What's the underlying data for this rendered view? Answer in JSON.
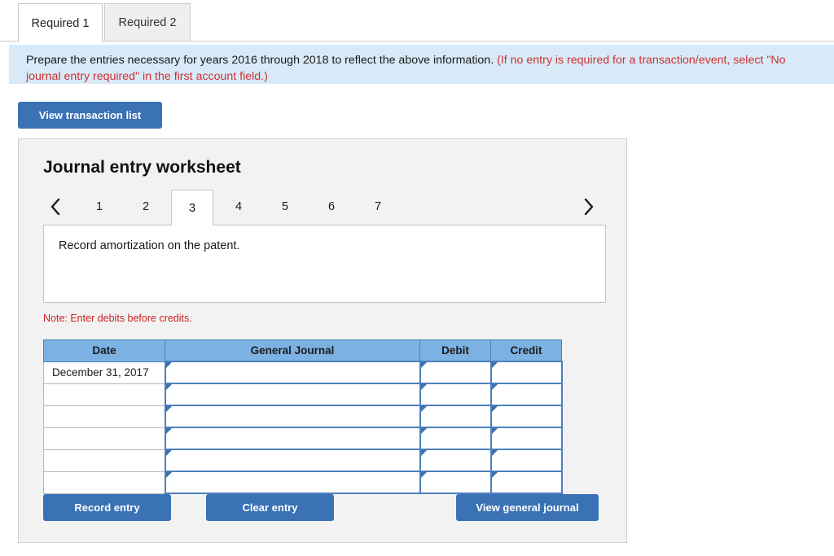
{
  "tabs": [
    {
      "label": "Required 1",
      "active": true
    },
    {
      "label": "Required 2",
      "active": false
    }
  ],
  "instruction": {
    "main": "Prepare the entries necessary for years 2016 through 2018 to reflect the above information.",
    "parenthetical": "(If no entry is required for a transaction/event, select \"No journal entry required\" in the first account field.)",
    "background_color": "#d8eaf8",
    "red_color": "#d03030"
  },
  "toolbar": {
    "view_transaction_list_label": "View transaction list"
  },
  "worksheet": {
    "title": "Journal entry worksheet",
    "pager": {
      "prev_icon": "chevron-left-icon",
      "next_icon": "chevron-right-icon",
      "pages": [
        "1",
        "2",
        "3",
        "4",
        "5",
        "6",
        "7"
      ],
      "active_page": "3"
    },
    "description": "Record amortization on the patent.",
    "note": "Note: Enter debits before credits.",
    "table": {
      "headers": [
        "Date",
        "General Journal",
        "Debit",
        "Credit"
      ],
      "rows": [
        {
          "date": "December 31, 2017",
          "general_journal": "",
          "debit": "",
          "credit": ""
        },
        {
          "date": "",
          "general_journal": "",
          "debit": "",
          "credit": ""
        },
        {
          "date": "",
          "general_journal": "",
          "debit": "",
          "credit": ""
        },
        {
          "date": "",
          "general_journal": "",
          "debit": "",
          "credit": ""
        },
        {
          "date": "",
          "general_journal": "",
          "debit": "",
          "credit": ""
        },
        {
          "date": "",
          "general_journal": "",
          "debit": "",
          "credit": ""
        }
      ],
      "header_color": "#7cb1e3"
    },
    "actions": {
      "record_entry_label": "Record entry",
      "clear_entry_label": "Clear entry",
      "view_general_journal_label": "View general journal"
    },
    "button_color": "#3a72b5"
  }
}
